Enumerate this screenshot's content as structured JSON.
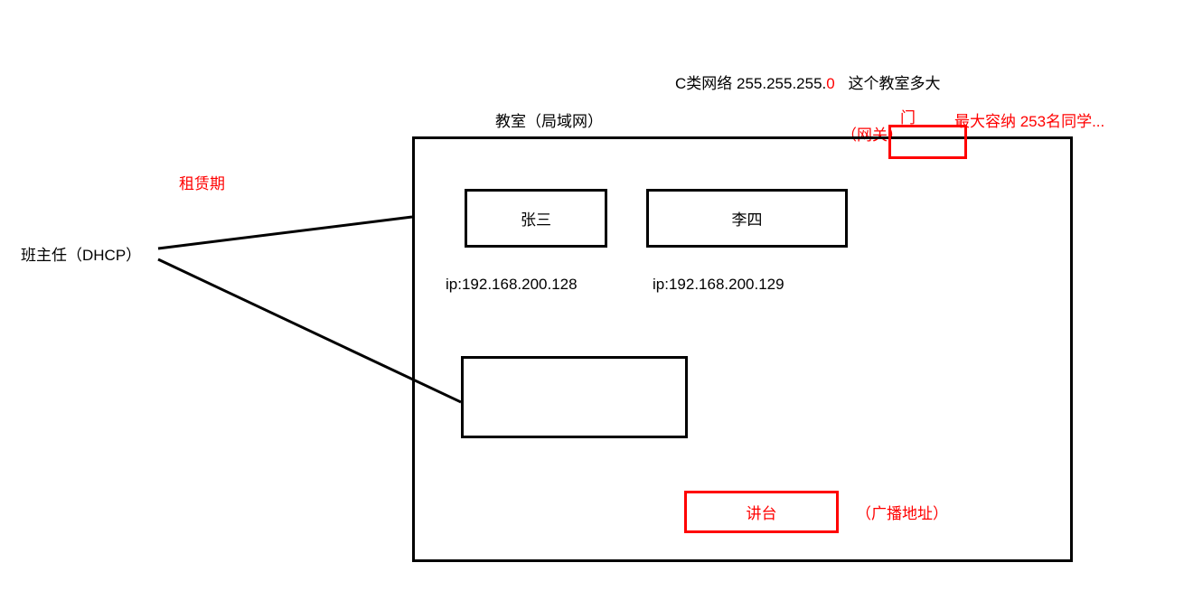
{
  "header": {
    "network_class_prefix": "C类网络 255.255.255.",
    "network_class_zero": "0",
    "room_size_question": "这个教室多大"
  },
  "labels": {
    "classroom_title": "教室（局域网）",
    "gateway_label": "（网关）",
    "gateway_door": "门",
    "max_capacity": "最大容纳 253名同学...",
    "lease_period": "租赁期",
    "homeroom_teacher": "班主任（DHCP）",
    "podium": "讲台",
    "broadcast_addr": "（广播地址）"
  },
  "hosts": {
    "host1_name": "张三",
    "host1_ip": "ip:192.168.200.128",
    "host2_name": "李四",
    "host2_ip": "ip:192.168.200.129"
  }
}
